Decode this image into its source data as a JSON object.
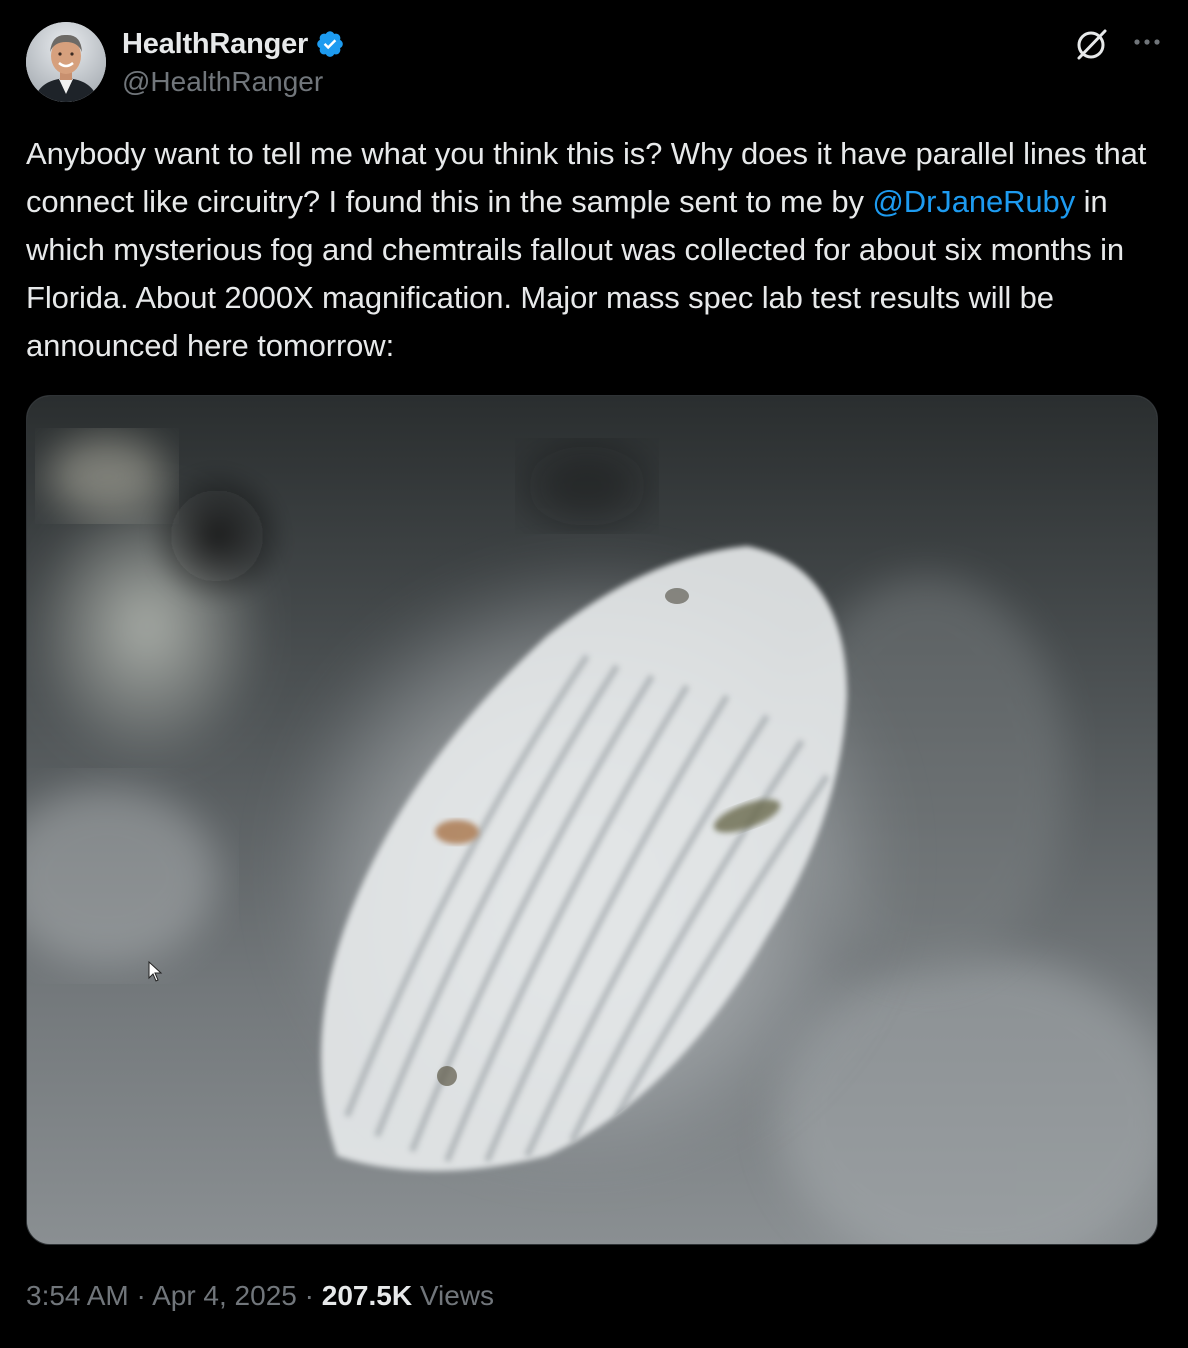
{
  "tweet": {
    "author": {
      "display_name": "HealthRanger",
      "handle": "@HealthRanger",
      "verified": true,
      "verified_color": "#1d9bf0"
    },
    "text": {
      "line1": "Anybody want to tell me what you think this is? Why does it have parallel lines that connect like circuitry? I found this in the sample sent to me by ",
      "mention": "@DrJaneRuby",
      "line2": " in which mysterious fog and chemtrails fallout was collected for about six months in Florida. About 2000X magnification. Major mass spec lab test results will be announced here tomorrow:"
    },
    "media": {
      "kind": "microscope-photo"
    },
    "meta": {
      "time": "3:54 AM",
      "separator": "·",
      "date": "Apr 4, 2025",
      "views_count": "207.5K",
      "views_label": "Views"
    },
    "icons": {
      "grok": "grok-icon",
      "more": "more-icon",
      "verified": "verified-badge-icon"
    }
  },
  "colors": {
    "background": "#000000",
    "text": "#e7e9ea",
    "secondary": "#71767b",
    "link": "#1d9bf0"
  }
}
